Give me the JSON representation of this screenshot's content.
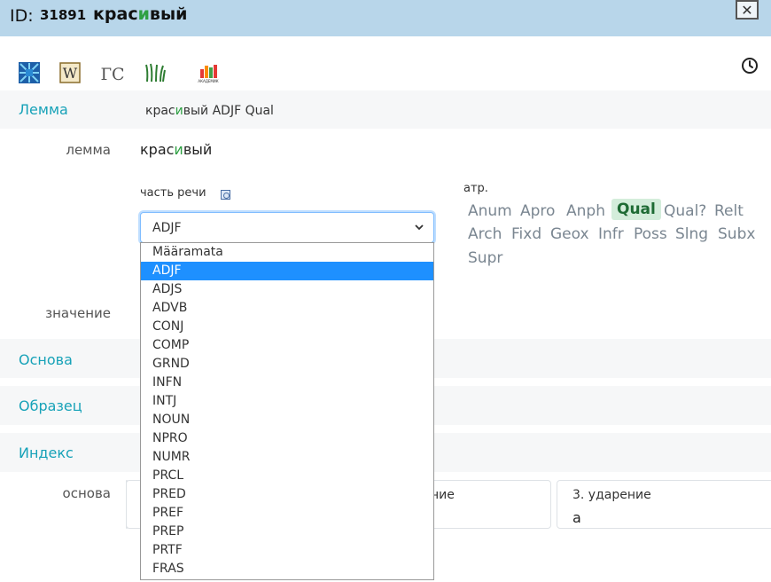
{
  "header": {
    "id_label": "ID:",
    "id_number": "31891",
    "word_before": "крас",
    "word_stress": "и",
    "word_after": "вый",
    "close_label": "✕"
  },
  "toolbar": {
    "icons": [
      "dictionary-grid-icon",
      "wikipedia-icon",
      "gc-icon",
      "grass-logo-icon",
      "akademik-icon"
    ],
    "akademik_text": "АКАДЕМИК",
    "gc_text": "ГС",
    "wiki_text": "W"
  },
  "sections": {
    "lemma_title": "Лемма",
    "lemma_summary_before": "крас",
    "lemma_summary_stress": "и",
    "lemma_summary_after": "вый ADJF Qual",
    "osnova_title": "Основа",
    "obrazec_title": "Образец",
    "index_title": "Индекс"
  },
  "fields": {
    "lemma_label": "лемма",
    "lemma_before": "крас",
    "lemma_stress": "и",
    "lemma_after": "вый",
    "znachenie_label": "значение",
    "osnova_label": "основа",
    "pos_label": "часть речи",
    "attr_label": "атр."
  },
  "pos_select": {
    "value": "ADJF",
    "options": [
      "Määramata",
      "ADJF",
      "ADJS",
      "ADVB",
      "CONJ",
      "COMP",
      "GRND",
      "INFN",
      "INTJ",
      "NOUN",
      "NPRO",
      "NUMR",
      "PRCL",
      "PRED",
      "PREF",
      "PREP",
      "PRTF",
      "FRAS"
    ],
    "selected_index": 1
  },
  "attributes": {
    "tags": [
      "Anum",
      "Apro",
      "Anph",
      "Qual",
      "Qual?",
      "Relt",
      "Arch",
      "Fixd",
      "Geox",
      "Infr",
      "Poss",
      "Slng",
      "Subx",
      "Supr"
    ],
    "active": "Qual"
  },
  "cards": {
    "card2_title_partial": "ние",
    "card3_title": "3. ударение",
    "card3_value": "а"
  },
  "colors": {
    "header_bg": "#b8d6ea",
    "section_link": "#17a2b8",
    "stress": "#2ea043",
    "selected_option": "#1e90ff",
    "active_tag_bg": "#d4eddb"
  }
}
